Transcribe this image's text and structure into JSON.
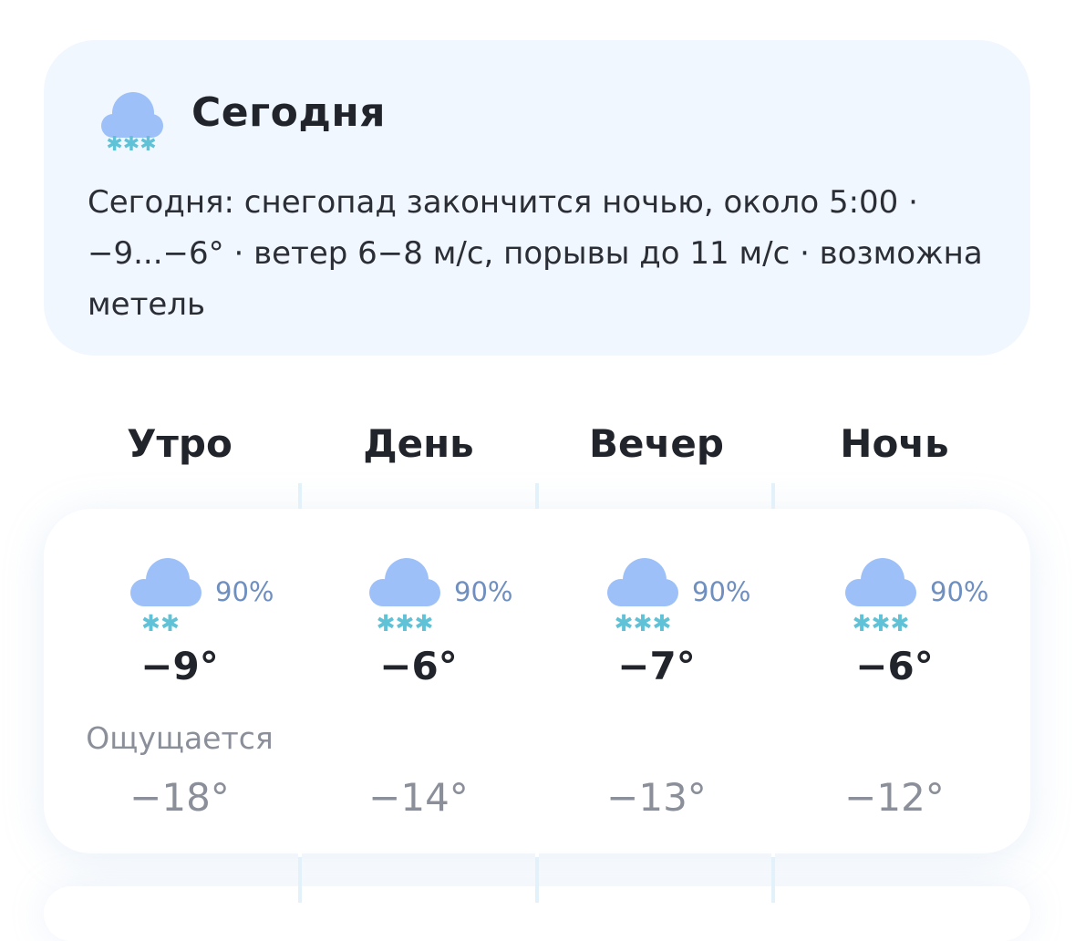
{
  "summary": {
    "icon": "snow-cloud-icon",
    "title": "Сегодня",
    "text": "Сегодня: снегопад закончится ночью, около 5:00 · −9...−6° · ветер 6−8 м/с, порывы до 11 м/с · возможна метель"
  },
  "colors": {
    "card_bg": "#f1f7ff",
    "cloud": "#9cc0f7",
    "snowflake": "#5fc2d6",
    "precip_text": "#6e8fbf",
    "muted_text": "#8b8f99"
  },
  "feels_label": "Ощущается",
  "periods": [
    {
      "name": "Утро",
      "icon": "cloud-light-snow-icon",
      "precip": "90%",
      "temp": "−9°",
      "feels": "−18°"
    },
    {
      "name": "День",
      "icon": "cloud-snow-icon",
      "precip": "90%",
      "temp": "−6°",
      "feels": "−14°"
    },
    {
      "name": "Вечер",
      "icon": "cloud-snow-icon",
      "precip": "90%",
      "temp": "−7°",
      "feels": "−13°"
    },
    {
      "name": "Ночь",
      "icon": "cloud-snow-icon",
      "precip": "90%",
      "temp": "−6°",
      "feels": "−12°"
    }
  ]
}
